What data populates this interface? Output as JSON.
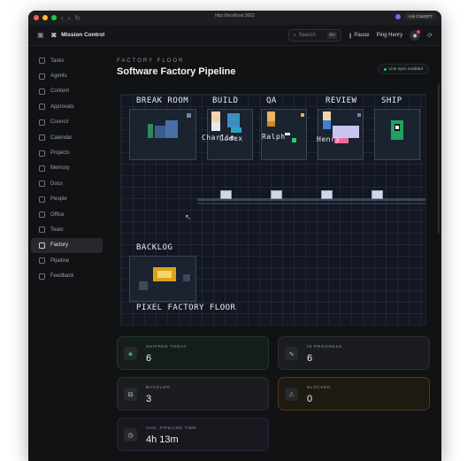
{
  "browser": {
    "url": "http://localhost:3002",
    "extension_label": "Ask ChatGPT"
  },
  "app": {
    "name": "Mission Control"
  },
  "topbar": {
    "search_placeholder": "Search",
    "search_shortcut": "⌘K",
    "pause_label": "Pause",
    "ping_label": "Ping Henry"
  },
  "sidebar": {
    "items": [
      {
        "label": "Tasks"
      },
      {
        "label": "Agents"
      },
      {
        "label": "Content"
      },
      {
        "label": "Approvals"
      },
      {
        "label": "Council"
      },
      {
        "label": "Calendar"
      },
      {
        "label": "Projects"
      },
      {
        "label": "Memory"
      },
      {
        "label": "Docs"
      },
      {
        "label": "People"
      },
      {
        "label": "Office"
      },
      {
        "label": "Team"
      },
      {
        "label": "Factory"
      },
      {
        "label": "Pipeline"
      },
      {
        "label": "Feedback"
      }
    ],
    "active": "Factory"
  },
  "page": {
    "eyebrow": "FACTORY FLOOR",
    "title": "Software Factory Pipeline",
    "sync_status": "Live sync enabled"
  },
  "floor": {
    "rooms": {
      "break_room": "BREAK ROOM",
      "build": "BUILD",
      "qa": "QA",
      "review": "REVIEW",
      "ship": "SHIP",
      "backlog": "BACKLOG"
    },
    "agents": {
      "charlie": "Charlie",
      "codex": "Codex",
      "ralph": "Ralph",
      "henry": "Henry"
    },
    "caption": "PIXEL FACTORY FLOOR"
  },
  "stats": {
    "shipped_today": {
      "label": "SHIPPED TODAY",
      "value": "6"
    },
    "in_progress": {
      "label": "IN PROGRESS",
      "value": "6"
    },
    "backlog": {
      "label": "BACKLOG",
      "value": "3"
    },
    "blocked": {
      "label": "BLOCKED",
      "value": "0"
    },
    "avg_pipeline_time": {
      "label": "AVG. PIPELINE TIME",
      "value": "4h 13m"
    }
  },
  "colors": {
    "accent_green": "#22c55e",
    "alert_red": "#ef4444",
    "amber": "#d9a21b"
  }
}
